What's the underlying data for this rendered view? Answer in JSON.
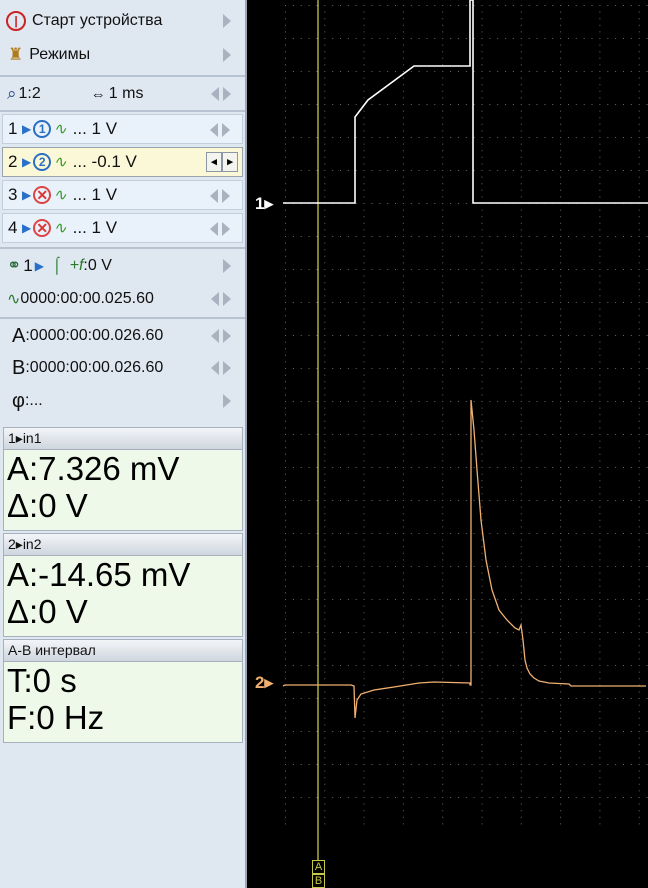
{
  "menu": {
    "start": "Старт устройства",
    "modes": "Режимы"
  },
  "timebase": {
    "zoom": "1:2",
    "time_per_div": "1 ms"
  },
  "channels": [
    {
      "num": "1",
      "circle": "1",
      "enabled": true,
      "value": "... 1 V"
    },
    {
      "num": "2",
      "circle": "2",
      "enabled": true,
      "value": "... -0.1 V"
    },
    {
      "num": "3",
      "circle": "3",
      "enabled": false,
      "value": "... 1 V"
    },
    {
      "num": "4",
      "circle": "4",
      "enabled": false,
      "value": "... 1 V"
    }
  ],
  "trigger": {
    "channel": "1",
    "level": ":0 V",
    "position": "0000:00:00.025.60"
  },
  "cursors": {
    "a_label": "A",
    "a_value": ":0000:00:00.026.60",
    "b_label": "B",
    "b_value": ":0000:00:00.026.60",
    "phi_label": "φ",
    "phi_value": ":..."
  },
  "measurements": [
    {
      "title": "1▸in1",
      "line1": "A:7.326 mV",
      "line2": "Δ:0 V"
    },
    {
      "title": "2▸in2",
      "line1": "A:-14.65 mV",
      "line2": "Δ:0 V"
    },
    {
      "title": "A-B интервал",
      "line1": "T:0 s",
      "line2": "F:0 Hz"
    }
  ],
  "scope": {
    "ch1_label": "1▸",
    "ch2_label": "2▸",
    "marker_a": "A",
    "marker_b": "B",
    "colors": {
      "background": "#000000",
      "grid": "#6a6a6a",
      "channel1": "#ffffff",
      "channel2": "#f0b070",
      "cursor": "#c8c846"
    }
  }
}
